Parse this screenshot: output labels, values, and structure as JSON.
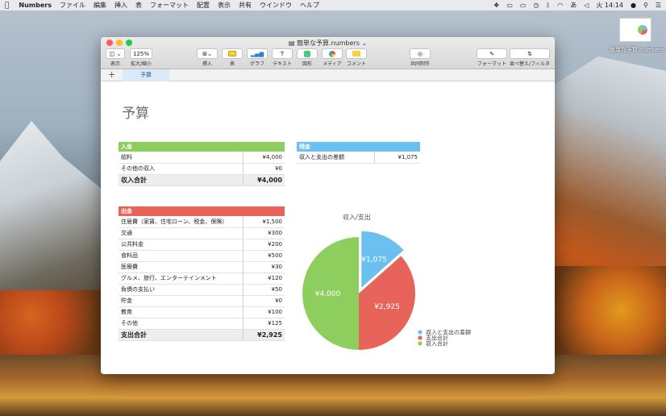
{
  "menubar": {
    "app_name": "Numbers",
    "menus": [
      "ファイル",
      "編集",
      "挿入",
      "表",
      "フォーマット",
      "配置",
      "表示",
      "共有",
      "ウインドウ",
      "ヘルプ"
    ],
    "clock": "火 14:14",
    "input_mode": "あ"
  },
  "desktop": {
    "file_label": "簡単な予算.numbers"
  },
  "window": {
    "title": "簡単な予算.numbers",
    "zoom": "125%",
    "toolbar": {
      "view": "表示",
      "zoom": "拡大/縮小",
      "insert": "挿入",
      "table": "表",
      "chart": "グラフ",
      "text": "テキスト",
      "shape": "図形",
      "media": "メディア",
      "comment": "コメント",
      "collaborate": "共同制作",
      "format": "フォーマット",
      "sort": "並べ替え/フィルタ"
    },
    "sheet_tab": "予算",
    "add_sheet": "+"
  },
  "doc": {
    "title": "予算",
    "income": {
      "header": "入金",
      "rows": [
        {
          "label": "給料",
          "value": "¥4,000"
        },
        {
          "label": "その他の収入",
          "value": "¥0"
        }
      ],
      "total_label": "収入合計",
      "total_value": "¥4,000"
    },
    "balance": {
      "header": "残金",
      "rows": [
        {
          "label": "収入と支出の差額",
          "value": "¥1,075"
        }
      ]
    },
    "expenses": {
      "header": "出金",
      "rows": [
        {
          "label": "住居費（家賃、住宅ローン、税金、保険）",
          "value": "¥1,500"
        },
        {
          "label": "交通",
          "value": "¥300"
        },
        {
          "label": "公共料金",
          "value": "¥200"
        },
        {
          "label": "食料品",
          "value": "¥500"
        },
        {
          "label": "医療費",
          "value": "¥30"
        },
        {
          "label": "グルメ、旅行、エンターテインメント",
          "value": "¥120"
        },
        {
          "label": "負債の支払い",
          "value": "¥50"
        },
        {
          "label": "貯金",
          "value": "¥0"
        },
        {
          "label": "教育",
          "value": "¥100"
        },
        {
          "label": "その他",
          "value": "¥125"
        }
      ],
      "total_label": "支出合計",
      "total_value": "¥2,925"
    }
  },
  "colors": {
    "green": "#8dce5e",
    "blue": "#6cc0ef",
    "red": "#e8645a"
  },
  "chart_data": {
    "type": "pie",
    "title": "収入/支出",
    "categories": [
      "収入と支出の差額",
      "支出合計",
      "収入合計"
    ],
    "values": [
      1075,
      2925,
      4000
    ],
    "data_labels": [
      "¥1,075",
      "¥2,925",
      "¥4,000"
    ],
    "colors": [
      "#6cc0ef",
      "#e8645a",
      "#8dce5e"
    ],
    "exploded": [
      true,
      false,
      false
    ],
    "legend": "bottom-right"
  }
}
